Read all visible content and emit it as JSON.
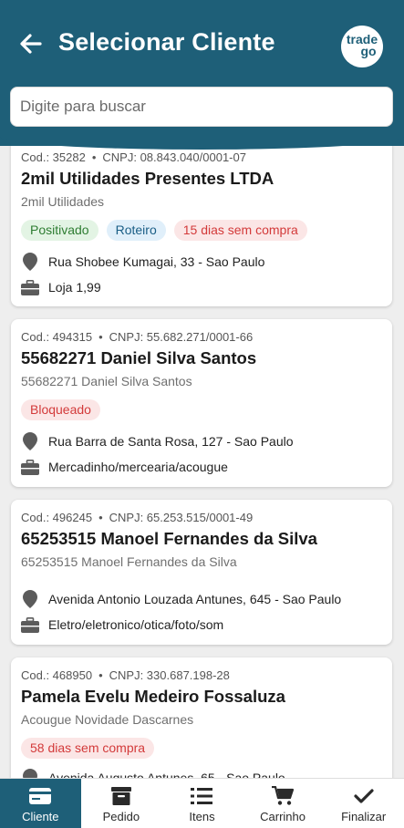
{
  "header": {
    "title": "Selecionar Cliente",
    "logo_line1": "trade",
    "logo_line2": "go",
    "back_icon": "arrow-left-icon"
  },
  "search": {
    "placeholder": "Digite para buscar",
    "value": ""
  },
  "colors": {
    "primary": "#1e5f78",
    "tag_green": "#2e7d32",
    "tag_blue": "#1a5e86",
    "tag_red": "#d33a3a"
  },
  "clients": [
    {
      "cod": "Cod.: 35282",
      "cnpj": "CNPJ: 08.843.040/0001-07",
      "name": "2mil Utilidades Presentes LTDA",
      "fantasy": "2mil Utilidades",
      "tags": [
        "Positivado",
        "Roteiro",
        "15 dias sem compra"
      ],
      "address": "Rua Shobee Kumagai, 33 - Sao Paulo",
      "segment": "Loja 1,99"
    },
    {
      "cod": "Cod.: 494315",
      "cnpj": "CNPJ: 55.682.271/0001-66",
      "name": "55682271 Daniel Silva Santos",
      "fantasy": "55682271 Daniel Silva Santos",
      "tags": [
        "Bloqueado"
      ],
      "address": "Rua Barra de Santa Rosa, 127 - Sao Paulo",
      "segment": "Mercadinho/mercearia/acougue"
    },
    {
      "cod": "Cod.: 496245",
      "cnpj": "CNPJ: 65.253.515/0001-49",
      "name": "65253515 Manoel Fernandes da Silva",
      "fantasy": "65253515 Manoel Fernandes da Silva",
      "tags": [],
      "address": "Avenida Antonio Louzada Antunes, 645 - Sao Paulo",
      "segment": "Eletro/eletronico/otica/foto/som"
    },
    {
      "cod": "Cod.: 468950",
      "cnpj": "CNPJ: 330.687.198-28",
      "name": "Pamela Evelu Medeiro Fossaluza",
      "fantasy": "Acougue Novidade Dascarnes",
      "tags": [
        "58 dias sem compra"
      ],
      "address": "Avenida Augusto Antunes, 65 - Sao Paulo",
      "segment": ""
    }
  ],
  "bottom_nav": [
    {
      "label": "Cliente",
      "icon": "id-card-icon",
      "active": true
    },
    {
      "label": "Pedido",
      "icon": "archive-box-icon",
      "active": false
    },
    {
      "label": "Itens",
      "icon": "list-icon",
      "active": false
    },
    {
      "label": "Carrinho",
      "icon": "cart-icon",
      "active": false
    },
    {
      "label": "Finalizar",
      "icon": "check-icon",
      "active": false
    }
  ]
}
